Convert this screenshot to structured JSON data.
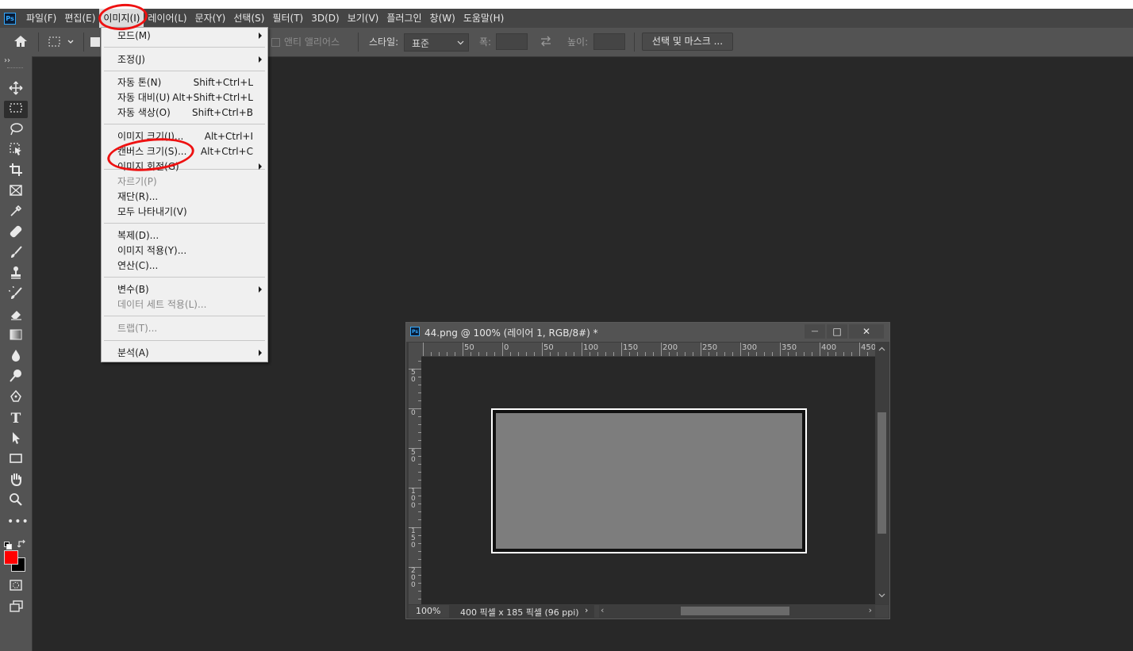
{
  "app": {
    "logo_text": "Ps",
    "accent_color": "#31a8ff"
  },
  "menubar": {
    "items": [
      "파일(F)",
      "편집(E)",
      "이미지(I)",
      "레이어(L)",
      "문자(Y)",
      "선택(S)",
      "필터(T)",
      "3D(D)",
      "보기(V)",
      "플러그인",
      "창(W)",
      "도움말(H)"
    ],
    "active": "이미지(I)"
  },
  "options": {
    "antialias_label": "앤티 앨리어스",
    "style_label": "스타일:",
    "style_value": "표준",
    "width_label": "폭:",
    "height_label": "높이:",
    "select_mask_label": "선택 및 마스크 ..."
  },
  "image_menu": {
    "items": [
      {
        "label": "모드(M)",
        "shortcut": "",
        "submenu": true,
        "disabled": false
      },
      {
        "label": "조정(J)",
        "shortcut": "",
        "submenu": true,
        "disabled": false
      },
      {
        "label": "자동 톤(N)",
        "shortcut": "Shift+Ctrl+L",
        "submenu": false,
        "disabled": false
      },
      {
        "label": "자동 대비(U)",
        "shortcut": "Alt+Shift+Ctrl+L",
        "submenu": false,
        "disabled": false
      },
      {
        "label": "자동 색상(O)",
        "shortcut": "Shift+Ctrl+B",
        "submenu": false,
        "disabled": false
      },
      {
        "label": "이미지 크기(I)...",
        "shortcut": "Alt+Ctrl+I",
        "submenu": false,
        "disabled": false
      },
      {
        "label": "캔버스 크기(S)...",
        "shortcut": "Alt+Ctrl+C",
        "submenu": false,
        "disabled": false
      },
      {
        "label": "이미지 회전(G)",
        "shortcut": "",
        "submenu": true,
        "disabled": false
      },
      {
        "label": "자르기(P)",
        "shortcut": "",
        "submenu": false,
        "disabled": true
      },
      {
        "label": "재단(R)...",
        "shortcut": "",
        "submenu": false,
        "disabled": false
      },
      {
        "label": "모두 나타내기(V)",
        "shortcut": "",
        "submenu": false,
        "disabled": false
      },
      {
        "label": "복제(D)...",
        "shortcut": "",
        "submenu": false,
        "disabled": false
      },
      {
        "label": "이미지 적용(Y)...",
        "shortcut": "",
        "submenu": false,
        "disabled": false
      },
      {
        "label": "연산(C)...",
        "shortcut": "",
        "submenu": false,
        "disabled": false
      },
      {
        "label": "변수(B)",
        "shortcut": "",
        "submenu": true,
        "disabled": false
      },
      {
        "label": "데이터 세트 적용(L)...",
        "shortcut": "",
        "submenu": false,
        "disabled": true
      },
      {
        "label": "트랩(T)...",
        "shortcut": "",
        "submenu": false,
        "disabled": true
      },
      {
        "label": "분석(A)",
        "shortcut": "",
        "submenu": true,
        "disabled": false
      }
    ]
  },
  "document": {
    "title": "44.png @ 100% (레이어 1, RGB/8#) *",
    "zoom": "100%",
    "info": "400 픽셀 x 185 픽셀 (96 ppi)",
    "h_ruler_labels": [
      "50",
      "0",
      "50",
      "100",
      "150",
      "200",
      "250",
      "300",
      "350",
      "400",
      "450"
    ],
    "v_ruler_labels": [
      "5\n0",
      "0",
      "5\n0",
      "1\n0\n0",
      "1\n5\n0",
      "2\n0\n0"
    ],
    "window_buttons": {
      "minimize": "—",
      "restore": "□",
      "close": "✕"
    }
  },
  "colors": {
    "foreground": "#ff0000",
    "background": "#000000",
    "annotation": "#ee1111"
  }
}
